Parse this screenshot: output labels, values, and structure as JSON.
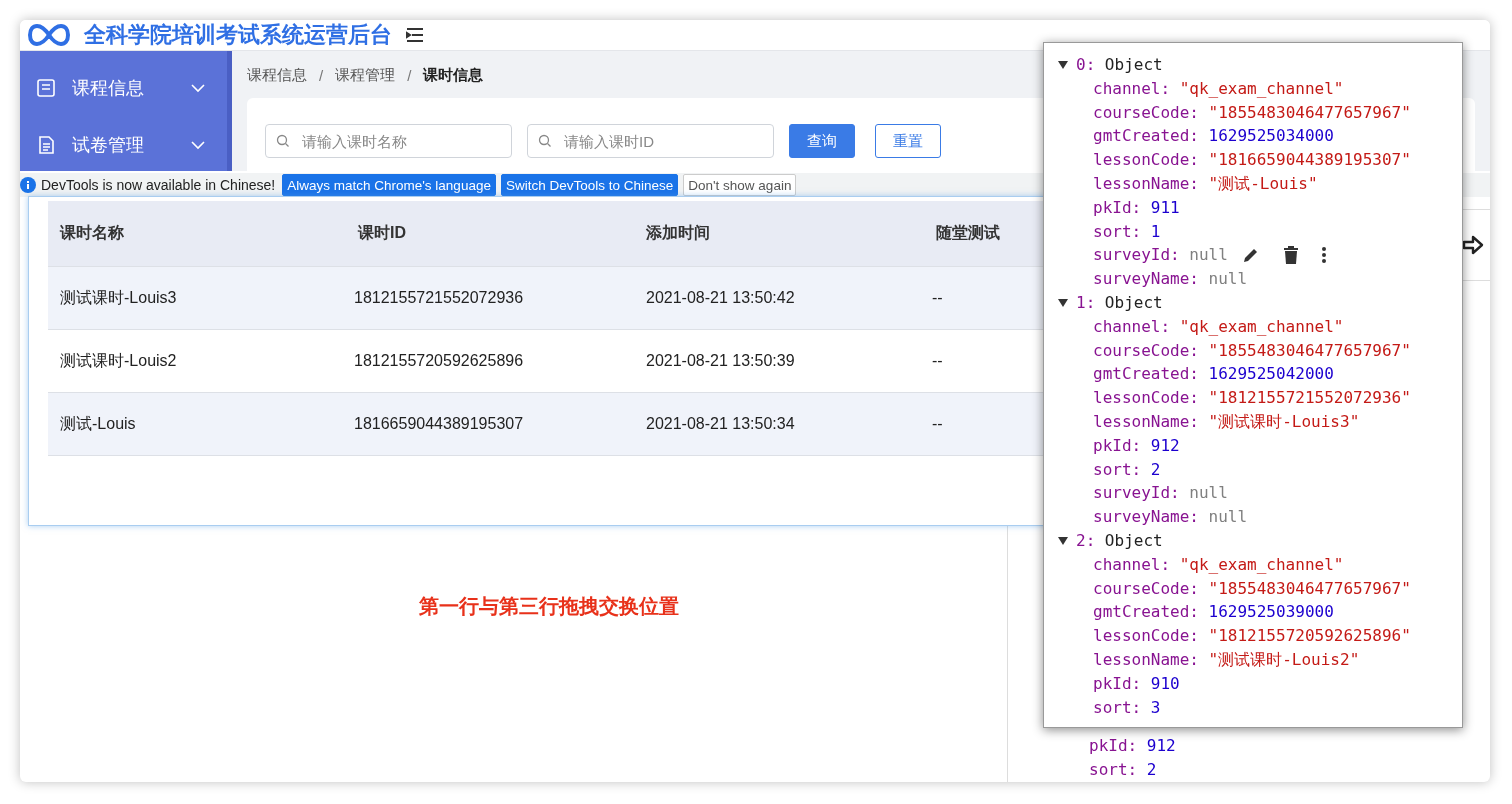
{
  "header": {
    "title": "全科学院培训考试系统运营后台"
  },
  "sidebar": {
    "items": [
      {
        "label": "课程信息"
      },
      {
        "label": "试卷管理"
      }
    ]
  },
  "breadcrumb": [
    {
      "label": "课程信息",
      "current": false
    },
    {
      "separator_before": "/",
      "label": "课程管理",
      "current": false
    },
    {
      "separator_before": "/",
      "label": "课时信息",
      "current": true
    }
  ],
  "search": {
    "fields": [
      {
        "placeholder": "请输入课时名称"
      },
      {
        "placeholder": "请输入课时ID"
      }
    ],
    "buttons": [
      {
        "label": "查询",
        "kind": "primary"
      },
      {
        "label": "重置",
        "kind": "default"
      }
    ]
  },
  "devtools_banner": {
    "message": "DevTools is now available in Chinese!",
    "buttons": [
      {
        "label": "Always match Chrome's language",
        "kind": "primary"
      },
      {
        "label": "Switch DevTools to Chinese",
        "kind": "primary"
      },
      {
        "label": "Don't show again",
        "kind": "default"
      }
    ]
  },
  "drag_table": {
    "columns": [
      "课时名称",
      "课时ID",
      "添加时间",
      "随堂测试"
    ],
    "rows": [
      [
        "测试课时-Louis3",
        "1812155721552072936",
        "2021-08-21 13:50:42",
        "--"
      ],
      [
        "测试课时-Louis2",
        "1812155720592625896",
        "2021-08-21 13:50:39",
        "--"
      ],
      [
        "测试-Louis",
        "1816659044389195307",
        "2021-08-21 13:50:34",
        "--"
      ]
    ]
  },
  "annotation": "第一行与第三行拖拽交换位置",
  "console": {
    "objects": [
      {
        "index": "0:",
        "type": "Object",
        "expanded": true,
        "props": [
          {
            "key": "channel:",
            "value": "\"qk_exam_channel\"",
            "kind": "string"
          },
          {
            "key": "courseCode:",
            "value": "\"1855483046477657967\"",
            "kind": "string"
          },
          {
            "key": "gmtCreated:",
            "value": "1629525034000",
            "kind": "number"
          },
          {
            "key": "lessonCode:",
            "value": "\"1816659044389195307\"",
            "kind": "string"
          },
          {
            "key": "lessonName:",
            "value": "\"测试-Louis\"",
            "kind": "string"
          },
          {
            "key": "pkId:",
            "value": "911",
            "kind": "number"
          },
          {
            "key": "sort:",
            "value": "1",
            "kind": "number"
          },
          {
            "key": "surveyId:",
            "value": "null",
            "kind": "null",
            "hovered": true
          },
          {
            "key": "surveyName:",
            "value": "null",
            "kind": "null"
          }
        ]
      },
      {
        "index": "1:",
        "type": "Object",
        "expanded": true,
        "props": [
          {
            "key": "channel:",
            "value": "\"qk_exam_channel\"",
            "kind": "string"
          },
          {
            "key": "courseCode:",
            "value": "\"1855483046477657967\"",
            "kind": "string"
          },
          {
            "key": "gmtCreated:",
            "value": "1629525042000",
            "kind": "number"
          },
          {
            "key": "lessonCode:",
            "value": "\"1812155721552072936\"",
            "kind": "string"
          },
          {
            "key": "lessonName:",
            "value": "\"测试课时-Louis3\"",
            "kind": "string"
          },
          {
            "key": "pkId:",
            "value": "912",
            "kind": "number"
          },
          {
            "key": "sort:",
            "value": "2",
            "kind": "number"
          },
          {
            "key": "surveyId:",
            "value": "null",
            "kind": "null"
          },
          {
            "key": "surveyName:",
            "value": "null",
            "kind": "null"
          }
        ]
      },
      {
        "index": "2:",
        "type": "Object",
        "expanded": true,
        "props": [
          {
            "key": "channel:",
            "value": "\"qk_exam_channel\"",
            "kind": "string"
          },
          {
            "key": "courseCode:",
            "value": "\"1855483046477657967\"",
            "kind": "string"
          },
          {
            "key": "gmtCreated:",
            "value": "1629525039000",
            "kind": "number"
          },
          {
            "key": "lessonCode:",
            "value": "\"1812155720592625896\"",
            "kind": "string"
          },
          {
            "key": "lessonName:",
            "value": "\"测试课时-Louis2\"",
            "kind": "string"
          },
          {
            "key": "pkId:",
            "value": "910",
            "kind": "number"
          },
          {
            "key": "sort:",
            "value": "3",
            "kind": "number"
          }
        ]
      }
    ],
    "background_lines": [
      {
        "key": "pkId:",
        "value": "912",
        "kind": "number"
      },
      {
        "key": "sort:",
        "value": "2",
        "kind": "number"
      }
    ]
  }
}
